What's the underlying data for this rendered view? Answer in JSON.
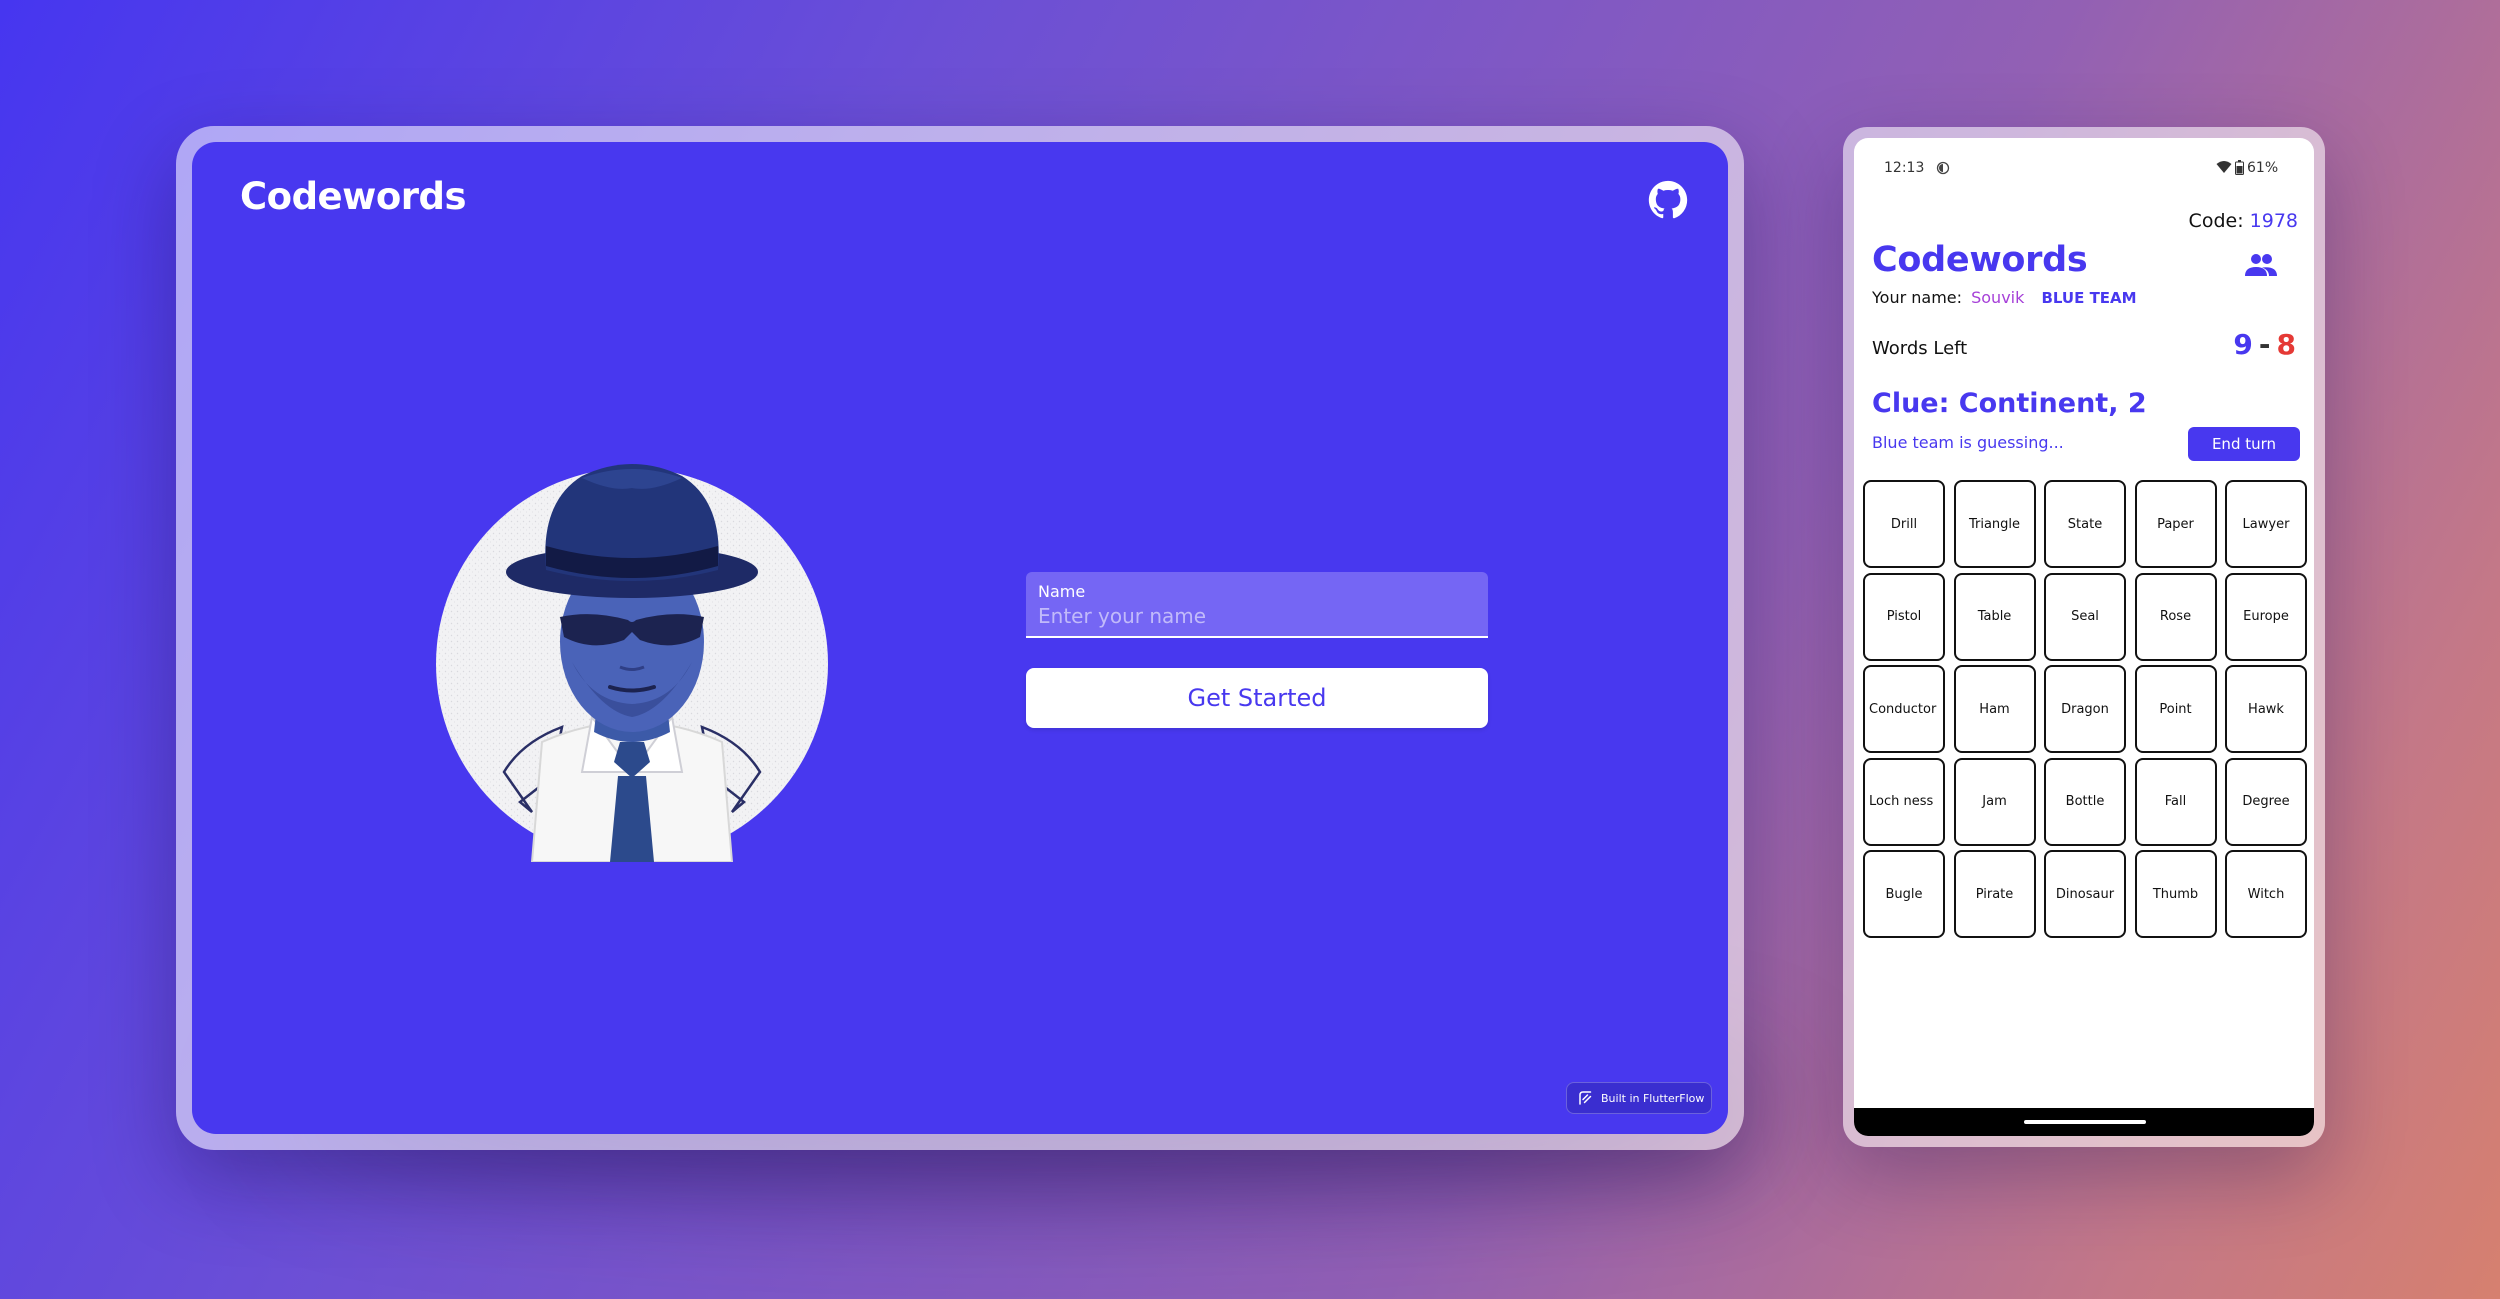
{
  "tablet": {
    "title": "Codewords",
    "name_label": "Name",
    "name_placeholder": "Enter your name",
    "name_value": "",
    "get_started_label": "Get Started",
    "badge_label": "Built in FlutterFlow"
  },
  "phone": {
    "status": {
      "time": "12:13",
      "battery": "61%"
    },
    "code_label": "Code:",
    "code_value": "1978",
    "title": "Codewords",
    "your_name_label": "Your name:",
    "player_name": "Souvik",
    "team": "BLUE TEAM",
    "words_left_label": "Words Left",
    "score_blue": "9",
    "score_sep": "-",
    "score_red": "8",
    "clue": "Clue: Continent, 2",
    "guessing": "Blue team is guessing...",
    "end_turn_label": "End turn",
    "words": [
      "Drill",
      "Triangle",
      "State",
      "Paper",
      "Lawyer",
      "Pistol",
      "Table",
      "Seal",
      "Rose",
      "Europe",
      "Conductor",
      "Ham",
      "Dragon",
      "Point",
      "Hawk",
      "Loch ness",
      "Jam",
      "Bottle",
      "Fall",
      "Degree",
      "Bugle",
      "Pirate",
      "Dinosaur",
      "Thumb",
      "Witch"
    ]
  },
  "colors": {
    "primary": "#4838ef",
    "red": "#e53935",
    "accent_purple": "#a640d8"
  },
  "icons": [
    "github-icon",
    "people-icon",
    "flutterflow-icon",
    "wifi-icon",
    "battery-icon",
    "do-not-disturb-icon"
  ]
}
